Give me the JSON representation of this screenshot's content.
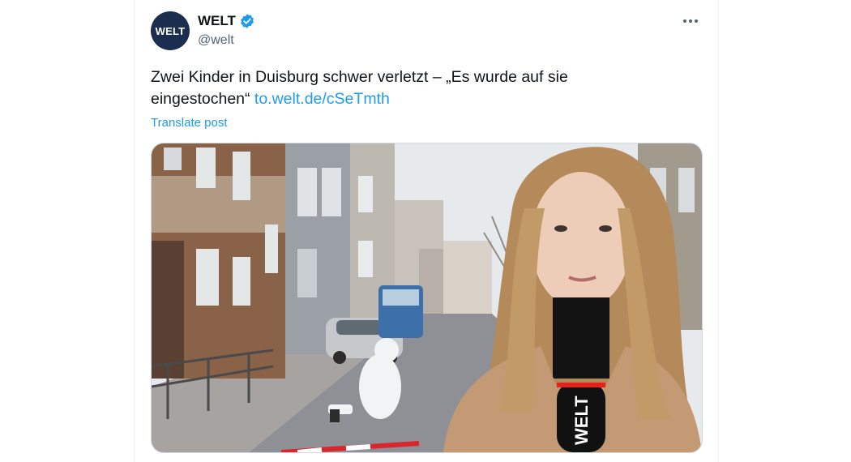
{
  "post": {
    "avatar_text": "WELT",
    "display_name": "WELT",
    "handle": "@welt",
    "verified": true,
    "verified_color": "#1d9bf0",
    "more_icon": "more-horizontal-icon",
    "text": "Zwei Kinder in Duisburg schwer verletzt – „Es wurde auf sie eingestochen“ ",
    "link_text": "to.welt.de/cSeTmth",
    "translate_label": "Translate post",
    "media": {
      "mic_label": "WELT"
    }
  },
  "colors": {
    "text": "#0f1419",
    "secondary": "#536471",
    "link": "#1d9bf0",
    "avatar_bg": "#1b2e4f"
  }
}
